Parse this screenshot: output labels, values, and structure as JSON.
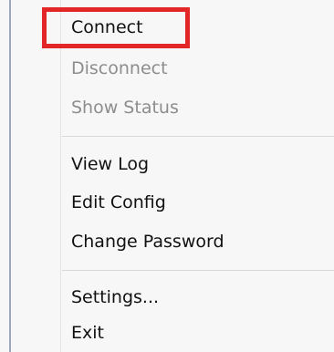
{
  "menu": {
    "items": [
      {
        "label": "Connect",
        "enabled": true
      },
      {
        "label": "Disconnect",
        "enabled": false
      },
      {
        "label": "Show Status",
        "enabled": false
      },
      {
        "label": "View Log",
        "enabled": true
      },
      {
        "label": "Edit Config",
        "enabled": true
      },
      {
        "label": "Change Password",
        "enabled": true
      },
      {
        "label": "Settings...",
        "enabled": true
      },
      {
        "label": "Exit",
        "enabled": true
      }
    ]
  },
  "highlight": {
    "target": "Connect",
    "color": "#e32727"
  }
}
